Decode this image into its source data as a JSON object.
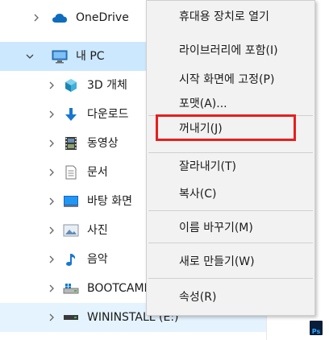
{
  "tree": {
    "items": [
      {
        "label": "OneDrive",
        "icon": "cloud-icon"
      },
      {
        "label": "내 PC",
        "icon": "computer-icon"
      },
      {
        "label": "3D 개체",
        "icon": "3d-objects-icon"
      },
      {
        "label": "다운로드",
        "icon": "download-arrow-icon"
      },
      {
        "label": "동영상",
        "icon": "film-icon"
      },
      {
        "label": "문서",
        "icon": "document-icon"
      },
      {
        "label": "바탕 화면",
        "icon": "desktop-icon"
      },
      {
        "label": "사진",
        "icon": "pictures-icon"
      },
      {
        "label": "음악",
        "icon": "music-note-icon"
      },
      {
        "label": "BOOTCAMP",
        "icon": "drive-icon"
      },
      {
        "label": "WININSTALL (E:)",
        "icon": "usb-drive-icon"
      }
    ]
  },
  "context_menu": {
    "items": [
      "휴대용 장치로 열기",
      "라이브러리에 포함(I)",
      "시작 화면에 고정(P)",
      "포맷(A)...",
      "꺼내기(J)",
      "잘라내기(T)",
      "복사(C)",
      "이름 바꾸기(M)",
      "새로 만들기(W)",
      "속성(R)"
    ],
    "highlight_color": "#e81e1e"
  },
  "side_icon": {
    "label": "Ps",
    "icon": "photoshop-file-icon"
  }
}
